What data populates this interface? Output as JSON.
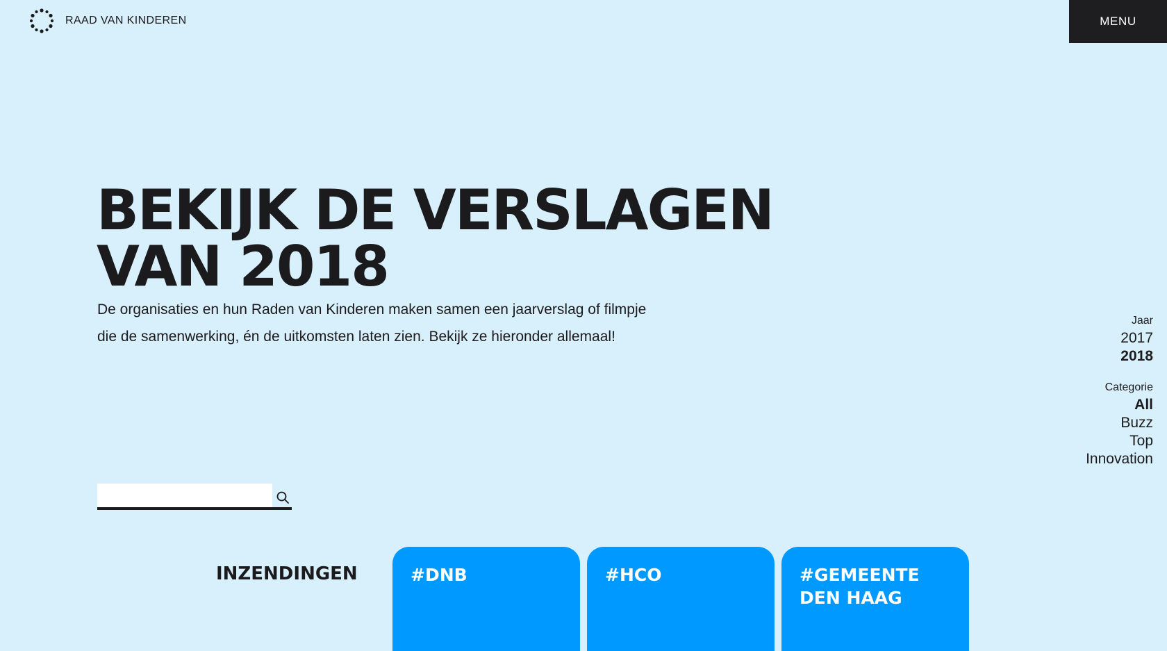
{
  "header": {
    "brand_name": "RAAD VAN KINDEREN",
    "menu_label": "MENU"
  },
  "hero": {
    "title_line1": "BEKIJK DE VERSLAGEN",
    "title_line2": "VAN 2018",
    "intro": "De organisaties en hun Raden van Kinderen maken samen een jaarverslag of filmpje die de samenwerking, én de uitkomsten laten zien. Bekijk ze hieronder allemaal!"
  },
  "search": {
    "value": "",
    "placeholder": "",
    "button_icon": "search-icon"
  },
  "filters": {
    "year": {
      "heading": "Jaar",
      "options": [
        {
          "label": "2017",
          "active": false
        },
        {
          "label": "2018",
          "active": true
        }
      ]
    },
    "category": {
      "heading": "Categorie",
      "options": [
        {
          "label": "All",
          "active": true
        },
        {
          "label": "Buzz",
          "active": false
        },
        {
          "label": "Top",
          "active": false
        },
        {
          "label": "Innovation",
          "active": false
        }
      ]
    }
  },
  "submissions": {
    "label": "INZENDINGEN",
    "cards": [
      {
        "title": "#DNB"
      },
      {
        "title": "#HCO"
      },
      {
        "title": "#GEMEENTE DEN HAAG"
      }
    ]
  },
  "colors": {
    "background": "#d8effc",
    "text": "#1b1b1d",
    "menu_background": "#1e1e20",
    "card_background": "#0099ff",
    "card_text": "#ffffff"
  }
}
